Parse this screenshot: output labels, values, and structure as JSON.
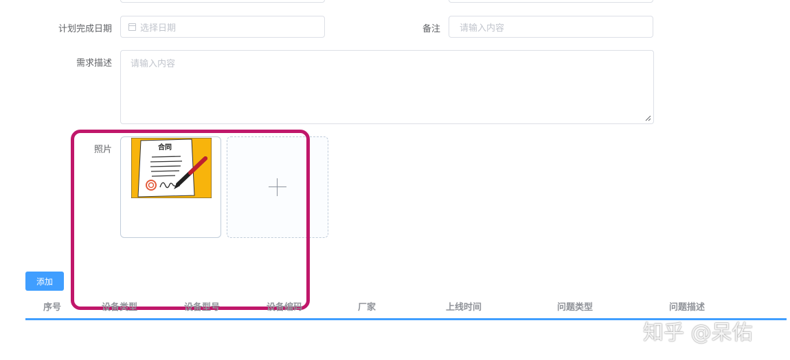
{
  "form": {
    "plan_date": {
      "label": "计划完成日期",
      "placeholder": "选择日期"
    },
    "remark": {
      "label": "备注",
      "placeholder": "请输入内容"
    },
    "description": {
      "label": "需求描述",
      "placeholder": "请输入内容"
    },
    "photo": {
      "label": "照片",
      "thumbnail_text": "合同"
    }
  },
  "table": {
    "add_label": "添加",
    "columns": [
      "序号",
      "设备类型",
      "设备型号",
      "设备编码",
      "厂家",
      "上线时间",
      "问题类型",
      "问题描述"
    ]
  },
  "watermark": "知乎 @呆佑",
  "colors": {
    "primary": "#409eff",
    "highlight": "#c0176a",
    "border": "#dcdfe6",
    "placeholder": "#c0c4cc"
  }
}
